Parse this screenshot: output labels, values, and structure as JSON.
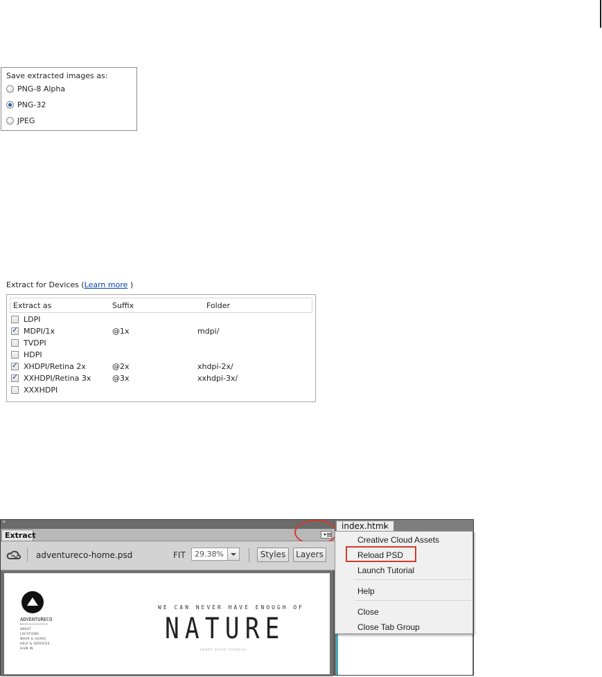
{
  "save_panel": {
    "title": "Save extracted images as:",
    "options": [
      {
        "label": "PNG-8 Alpha",
        "checked": false
      },
      {
        "label": "PNG-32",
        "checked": true
      },
      {
        "label": "JPEG",
        "checked": false
      }
    ]
  },
  "devices": {
    "title_prefix": "Extract for Devices (",
    "learn_more": "Learn more",
    "title_suffix": ")",
    "headers": {
      "extract_as": "Extract as",
      "suffix": "Suffix",
      "folder": "Folder"
    },
    "rows": [
      {
        "name": "LDPI",
        "suffix": "",
        "folder": "",
        "checked": false
      },
      {
        "name": "MDPI/1x",
        "suffix": "@1x",
        "folder": "mdpi/",
        "checked": true
      },
      {
        "name": "TVDPI",
        "suffix": "",
        "folder": "",
        "checked": false
      },
      {
        "name": "HDPI",
        "suffix": "",
        "folder": "",
        "checked": false
      },
      {
        "name": "XHDPI/Retina 2x",
        "suffix": "@2x",
        "folder": "xhdpi-2x/",
        "checked": true
      },
      {
        "name": "XXHDPI/Retina 3x",
        "suffix": "@3x",
        "folder": "xxhdpi-3x/",
        "checked": true
      },
      {
        "name": "XXXHDPI",
        "suffix": "",
        "folder": "",
        "checked": false
      }
    ]
  },
  "extract_panel": {
    "collapse_glyph": "«",
    "tab_label": "Extract",
    "file_name": "adventureco-home.psd",
    "fit_label": "FIT",
    "zoom_value": "29.38%",
    "styles_label": "Styles",
    "layers_label": "Layers",
    "highlight_color": "#d33a2a",
    "preview": {
      "brand": "ADVENTURECO",
      "nav": [
        "ABOUT",
        "LOCATIONS",
        "WEAR & GEARS",
        "HELP & SERVICES",
        "SIGN IN"
      ],
      "tagline": "WE CAN NEVER HAVE ENOUGH OF",
      "headline": "NATURE",
      "subline": "HENRY DAVID THOREAU"
    }
  },
  "doc_tab": {
    "label": "index.html",
    "close": "×"
  },
  "context_menu": {
    "items": [
      "Creative Cloud Assets",
      "Reload PSD",
      "Launch Tutorial",
      "Help",
      "Close",
      "Close Tab Group"
    ]
  }
}
